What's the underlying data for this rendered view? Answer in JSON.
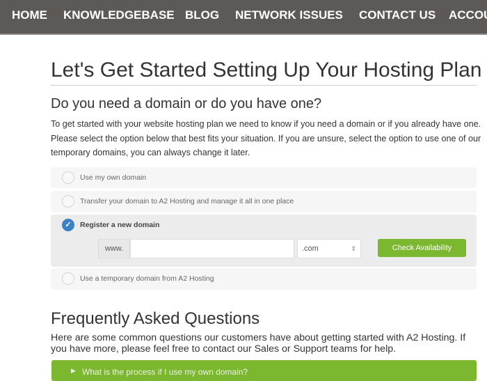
{
  "nav": {
    "items": [
      "HOME",
      "KNOWLEDGEBASE",
      "BLOG",
      "NETWORK ISSUES",
      "CONTACT US",
      "ACCOU"
    ]
  },
  "page_title": "Let's Get Started Setting Up Your Hosting Plan",
  "domain_section": {
    "heading": "Do you need a domain or do you have one?",
    "intro": "To get started with your website hosting plan we need to know if you need a domain or if you already have one. Please select the option below that best fits your situation. If you are unsure, select the option to use one of our temporary domains, you can always change it later.",
    "options": [
      "Use my own domain",
      "Transfer your domain to A2 Hosting and manage it all in one place",
      "Register a new domain",
      "Use a temporary domain from A2 Hosting"
    ],
    "selected": "Register a new domain",
    "register": {
      "prefix": "www.",
      "domain_value": "",
      "tld": ".com",
      "check_label": "Check Availability"
    }
  },
  "faq": {
    "heading": "Frequently Asked Questions",
    "intro": "Here are some common questions our customers have about getting started with A2 Hosting. If you have more, please feel free to contact our Sales or Support teams for help.",
    "items": [
      "What is the process if I use my own domain?"
    ]
  },
  "colors": {
    "nav_bg": "#5d5957",
    "accent_green": "#7cb82f",
    "radio_selected": "#3a82c4"
  }
}
